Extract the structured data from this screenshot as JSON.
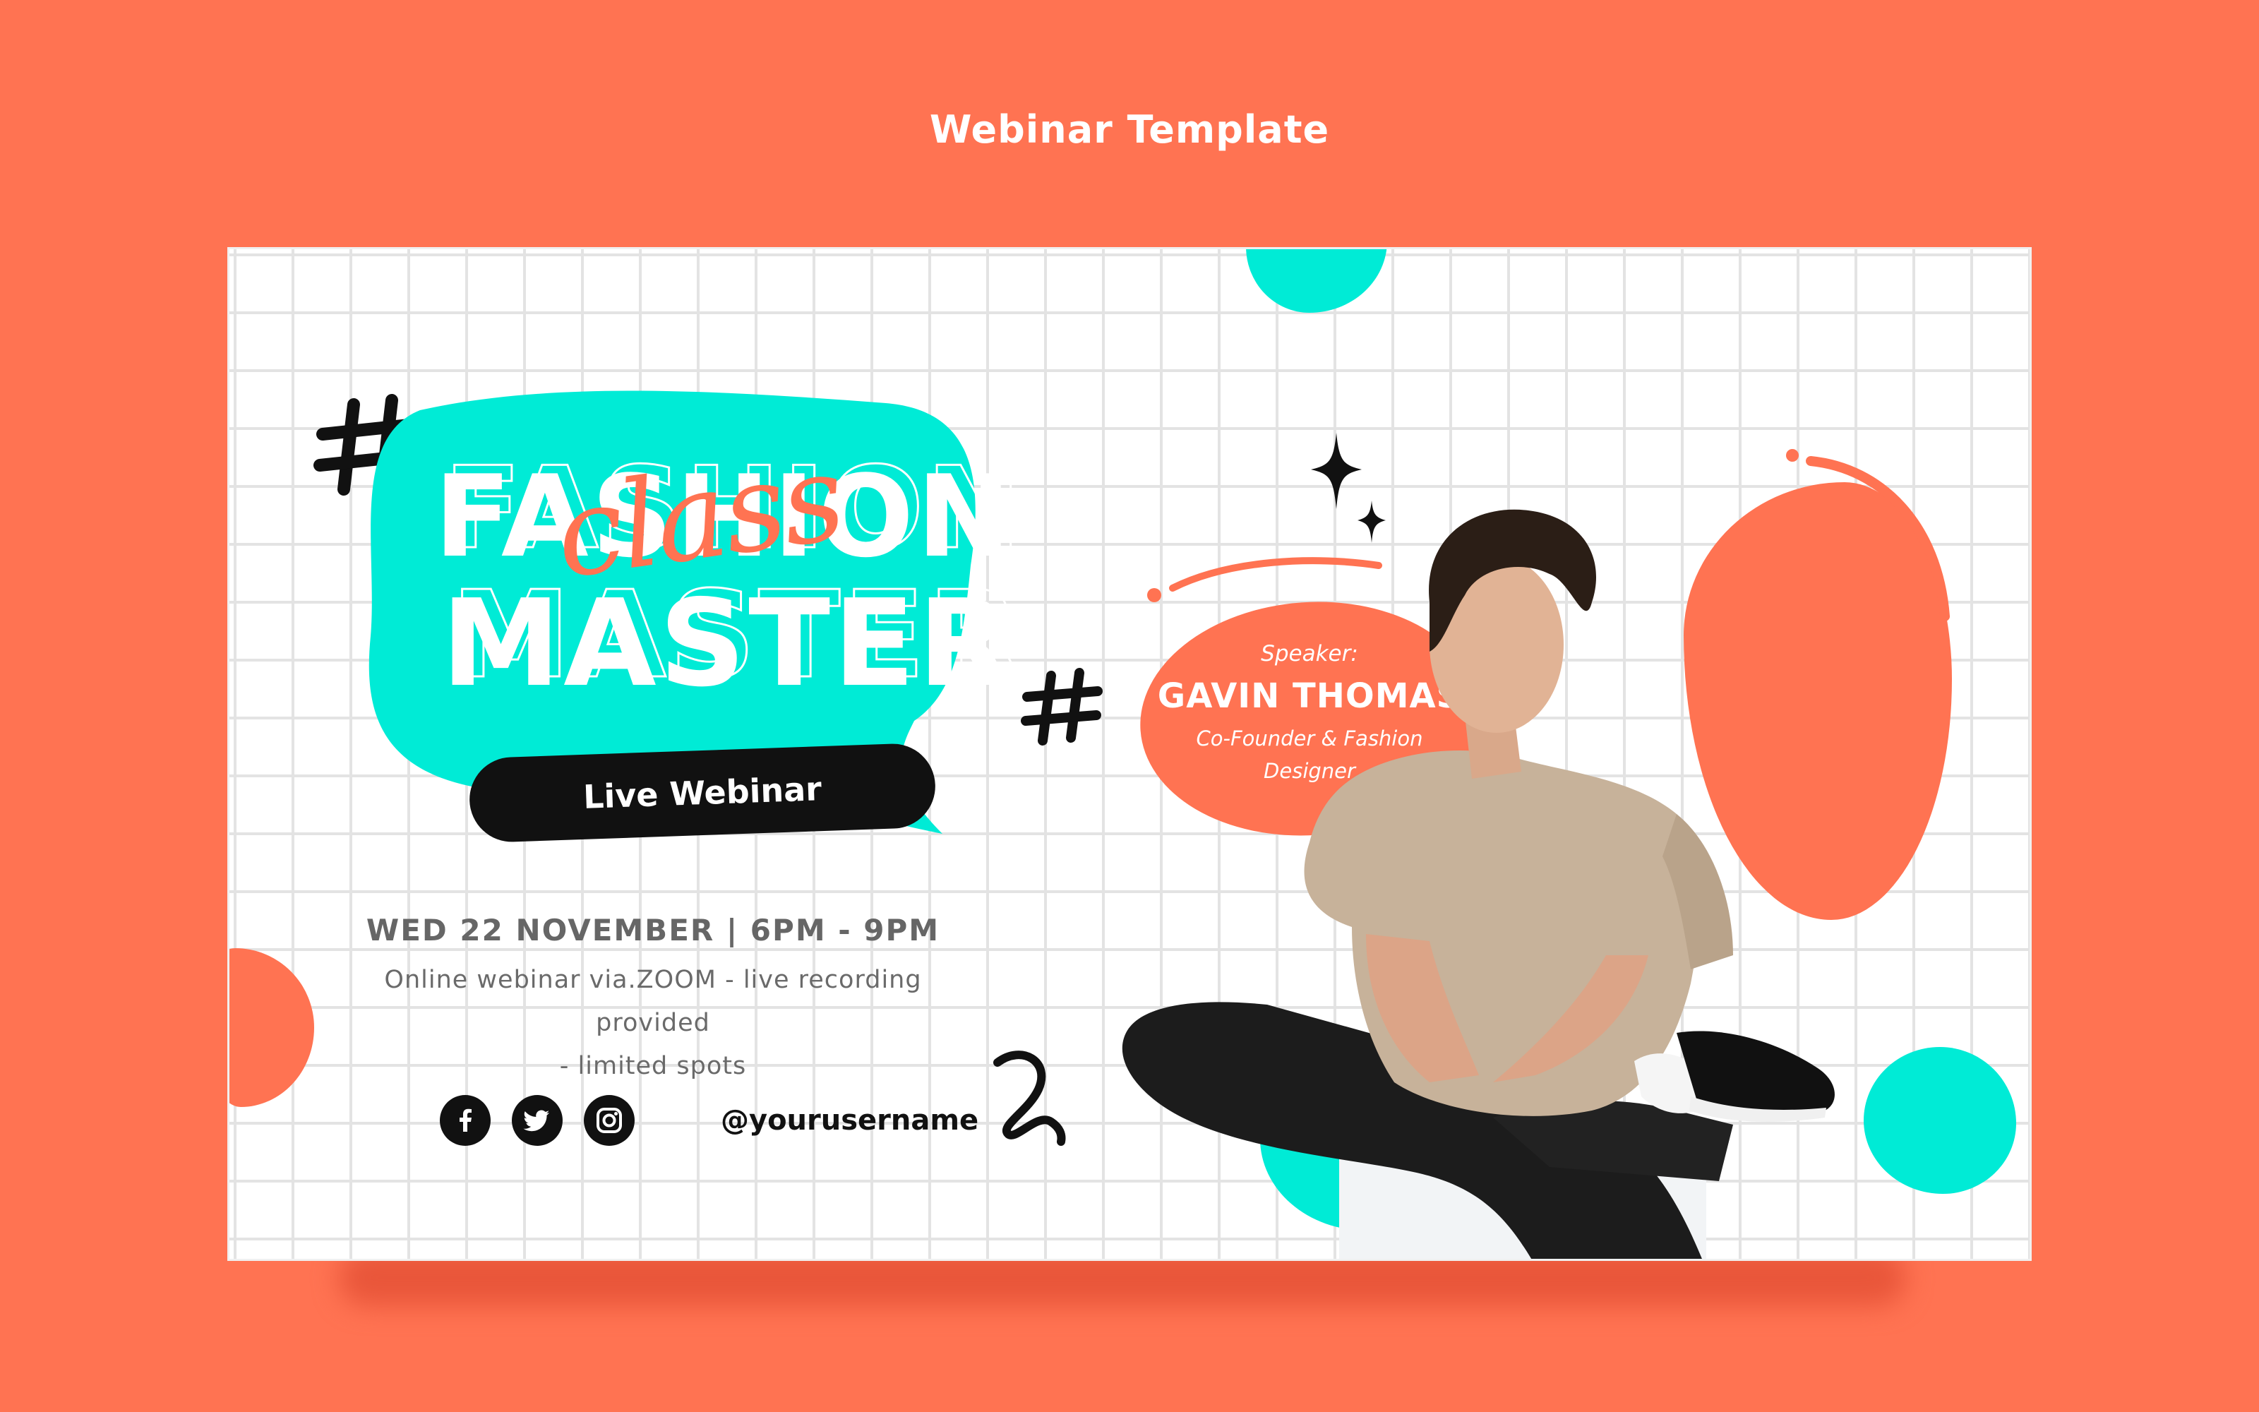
{
  "page": {
    "title": "Webinar Template"
  },
  "banner": {
    "headline_top": "FASHION",
    "headline_script": "class",
    "headline_bottom": "MASTER",
    "badge": "Live Webinar",
    "date_time": "WED 22 NOVEMBER | 6PM - 9PM",
    "description_line1": "Online webinar via.ZOOM - live recording provided",
    "description_line2": "- limited spots",
    "social": {
      "icons": [
        "facebook-icon",
        "twitter-icon",
        "instagram-icon"
      ],
      "username": "@yourusername"
    },
    "speaker": {
      "label": "Speaker:",
      "name": "GAVIN THOMAS",
      "role_line1": "Co-Founder & Fashion",
      "role_line2": "Designer"
    }
  },
  "colors": {
    "background": "#FF7352",
    "accent_teal": "#00EBD6",
    "accent_coral": "#FF7352",
    "dark": "#111111",
    "card": "#FFFFFF",
    "grid": "#E3E3E3"
  }
}
